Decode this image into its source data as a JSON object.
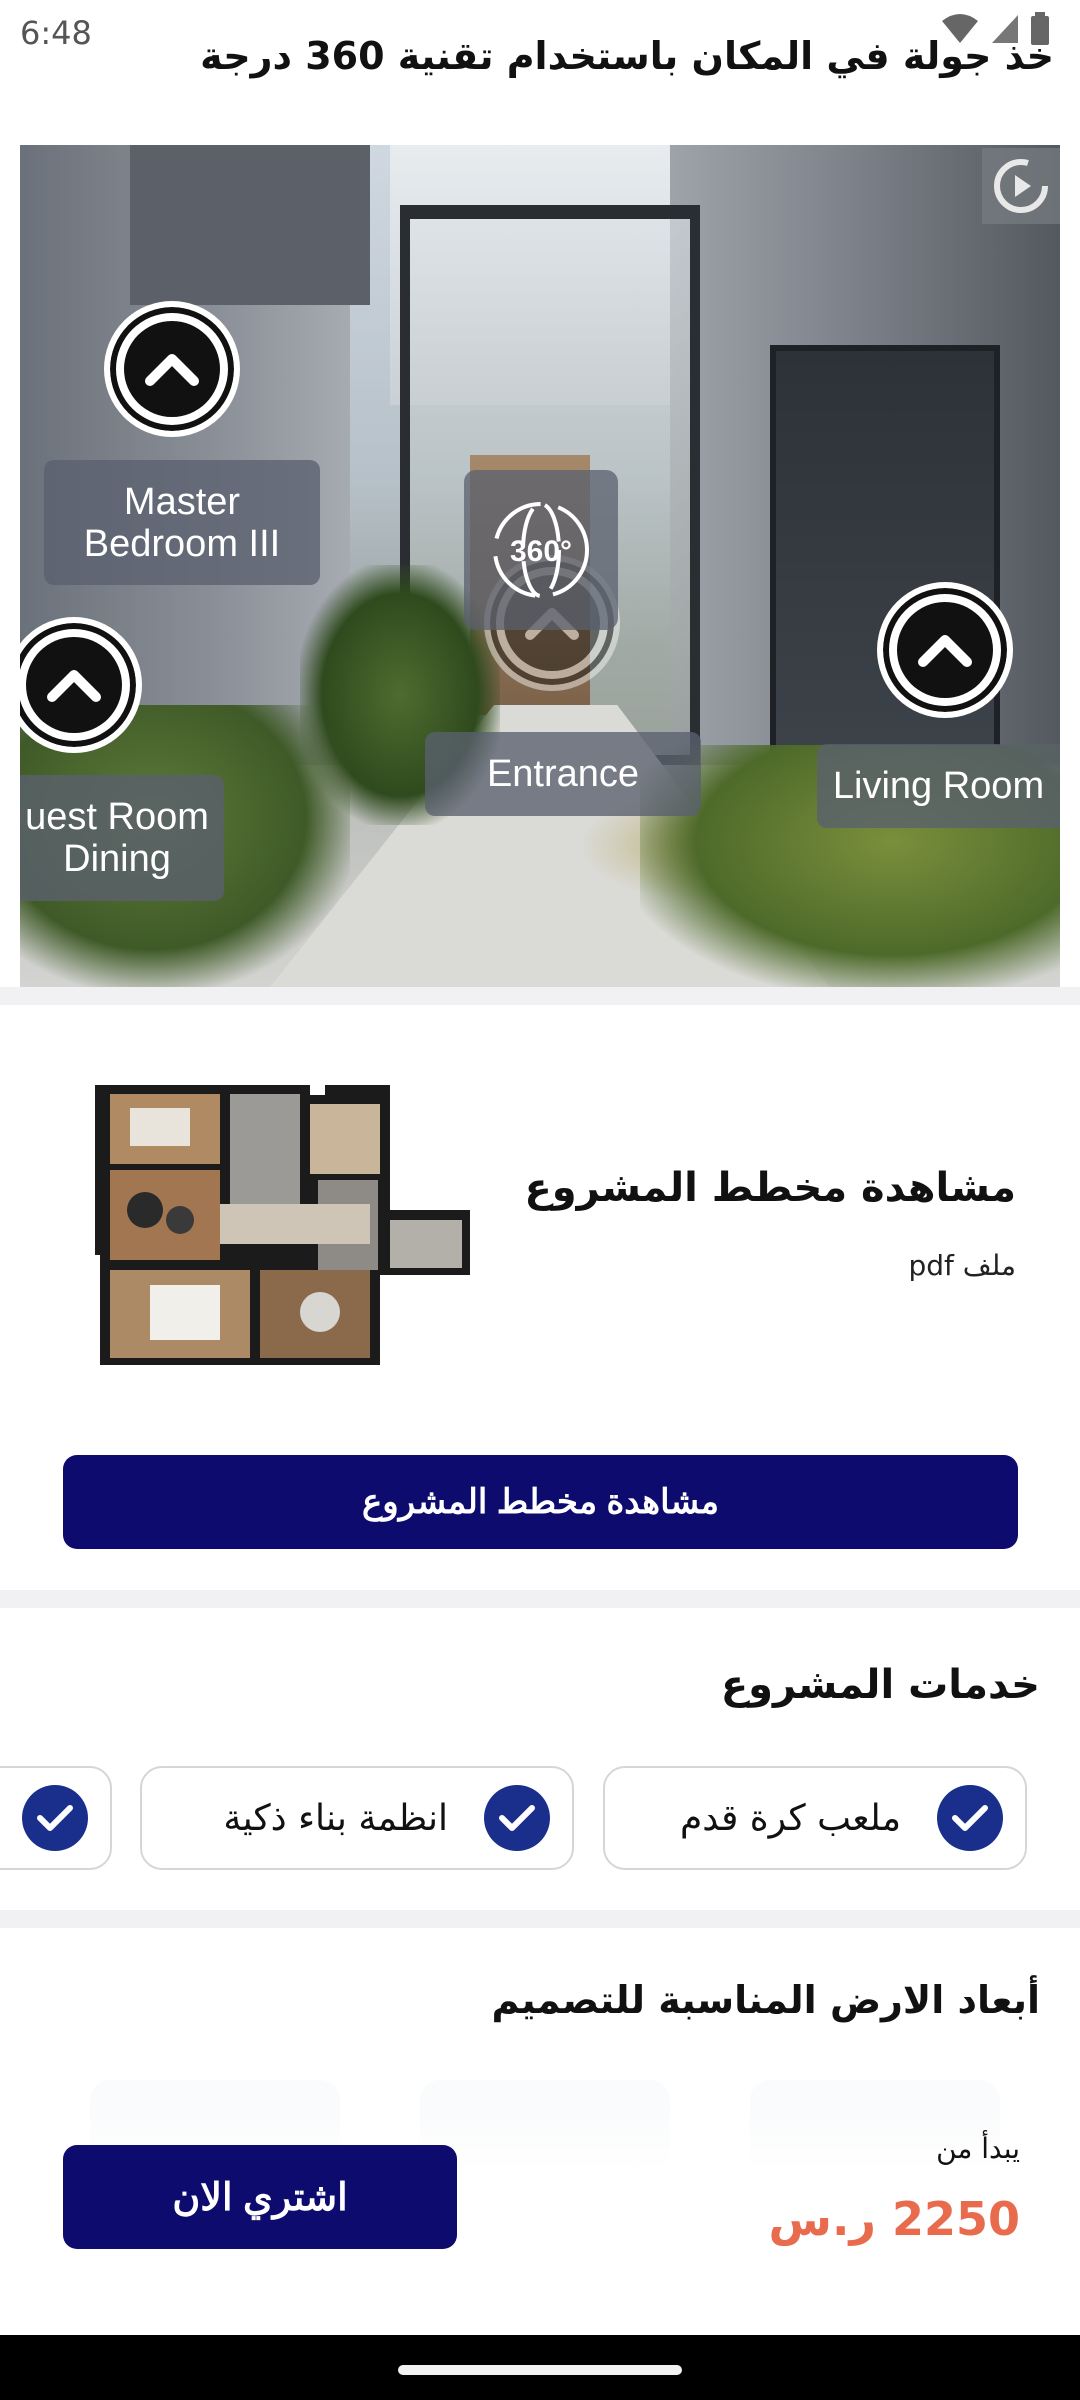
{
  "status_bar": {
    "time": "6:48"
  },
  "tour_heading": "خذ جولة في المكان باستخدام تقنية 360 درجة",
  "panorama": {
    "hotspots": [
      {
        "label_line1": "Master",
        "label_line2": "Bedroom III"
      },
      {
        "label_line1": "uest Room",
        "label_line2": "Dining"
      },
      {
        "label_line1": "Entrance"
      },
      {
        "label_line1": "Living Room"
      }
    ],
    "badge_text": "360°"
  },
  "plan": {
    "title": "مشاهدة مخطط المشروع",
    "file_type": "ملف pdf",
    "button_label": "مشاهدة مخطط المشروع"
  },
  "services": {
    "title": "خدمات المشروع",
    "items": [
      "ملعب كرة قدم",
      "انظمة بناء ذكية"
    ]
  },
  "dimensions": {
    "title": "أبعاد الارض المناسبة للتصميم"
  },
  "purchase": {
    "starts_from": "يبدأ من",
    "price": "2250 ر.س",
    "buy_label": "اشتري الان"
  },
  "colors": {
    "primary": "#0e0b6e",
    "check": "#1a2f8c",
    "price": "#e86b4e"
  }
}
